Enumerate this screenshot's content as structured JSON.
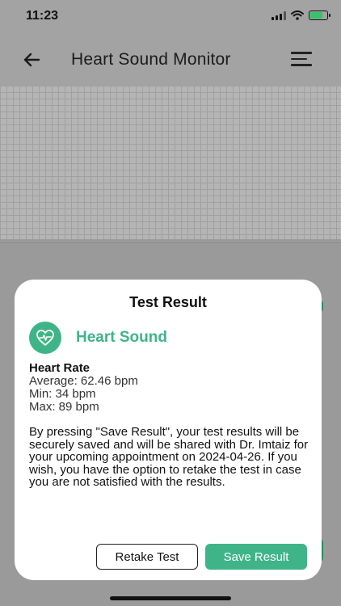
{
  "status_bar": {
    "time": "11:23"
  },
  "app_bar": {
    "title": "Heart Sound Monitor"
  },
  "modal": {
    "title": "Test Result",
    "section_label": "Heart Sound",
    "heart_rate": {
      "title": "Heart Rate",
      "average": "Average: 62.46 bpm",
      "min": "Min: 34 bpm",
      "max": "Max: 89 bpm"
    },
    "note": "By pressing \"Save Result\", your test results will be securely saved and will be shared with Dr. Imtaiz for your upcoming appointment on 2024-04-26. If you wish, you have the option to retake the test in case you are not satisfied with the results.",
    "buttons": {
      "retake": "Retake Test",
      "save": "Save Result"
    }
  },
  "colors": {
    "accent": "#3fb489",
    "scrim": "#9a9a9a",
    "battery": "#38c26a"
  },
  "icons": {
    "back": "arrow-left-icon",
    "menu": "menu-icon",
    "heart_sound": "heart-pulse-icon",
    "wifi": "wifi-icon",
    "battery": "battery-icon",
    "signal": "signal-icon"
  }
}
